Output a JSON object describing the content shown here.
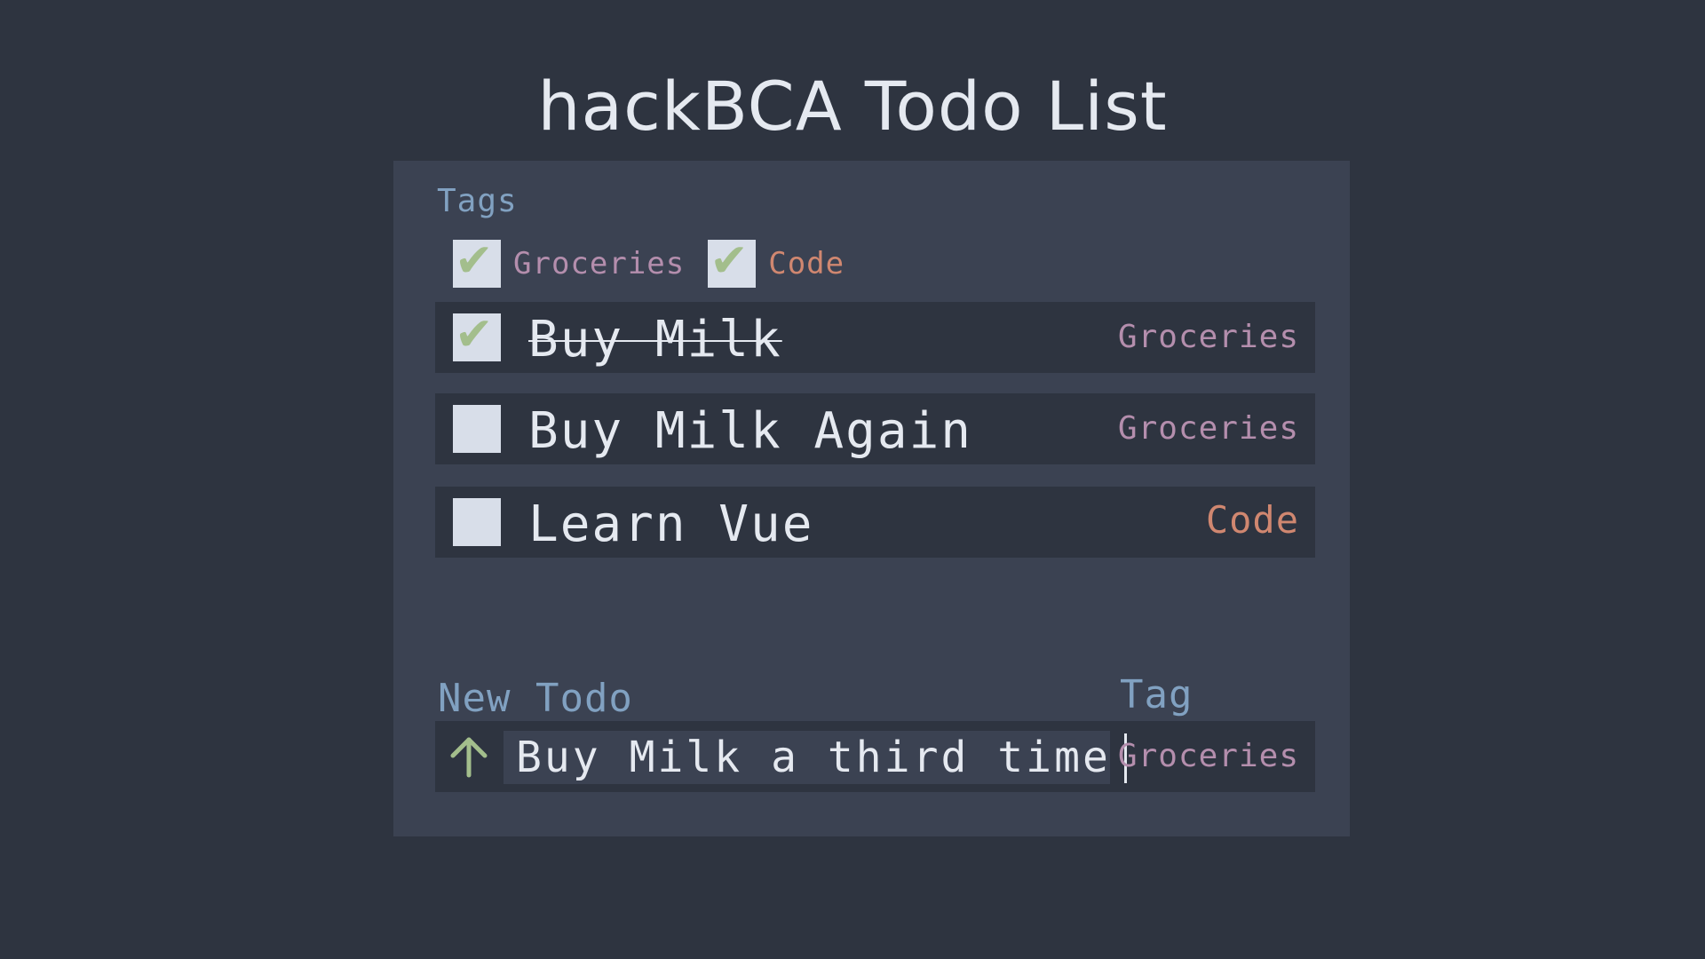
{
  "app": {
    "title": "hackBCA Todo List"
  },
  "colors": {
    "background": "#2e3440",
    "panel": "#3b4252",
    "label": "#81a1c1",
    "check": "#a3be8c",
    "groceries_tag": "#b48ead",
    "code_tag": "#d08770"
  },
  "tags_section": {
    "label": "Tags",
    "filters": [
      {
        "label": "Groceries",
        "checked": true,
        "icon": "checkmark-icon"
      },
      {
        "label": "Code",
        "checked": true,
        "icon": "checkmark-icon"
      }
    ]
  },
  "todos": [
    {
      "text": "Buy Milk",
      "done": true,
      "tag": "Groceries"
    },
    {
      "text": "Buy Milk Again",
      "done": false,
      "tag": "Groceries"
    },
    {
      "text": "Learn Vue",
      "done": false,
      "tag": "Code"
    }
  ],
  "new_todo": {
    "label": "New Todo",
    "tag_label": "Tag",
    "input_value": "Buy Milk a third time",
    "selected_tag": "Groceries",
    "submit_icon": "arrow-up-icon"
  }
}
